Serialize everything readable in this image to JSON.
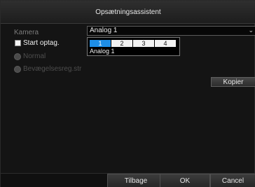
{
  "title": "Opsætningsassistent",
  "camera": {
    "label": "Kamera",
    "selected": "Analog 1",
    "dropdown": {
      "tabs": [
        "1",
        "2",
        "3",
        "4"
      ],
      "active_tab": "1",
      "items": [
        "Analog 1"
      ]
    }
  },
  "start_record": {
    "label": "Start optag.",
    "checked": true
  },
  "modes": [
    {
      "label": "Normal",
      "enabled": false
    },
    {
      "label": "Bevægelsesreg.str",
      "enabled": false
    }
  ],
  "copy_button": "Kopier",
  "footer": {
    "back": "Tilbage",
    "ok": "OK",
    "cancel": "Cancel"
  },
  "icons": {
    "dropdown": "chevron-down-icon"
  },
  "colors": {
    "accent": "#1e8ee6",
    "background": "#141414"
  }
}
